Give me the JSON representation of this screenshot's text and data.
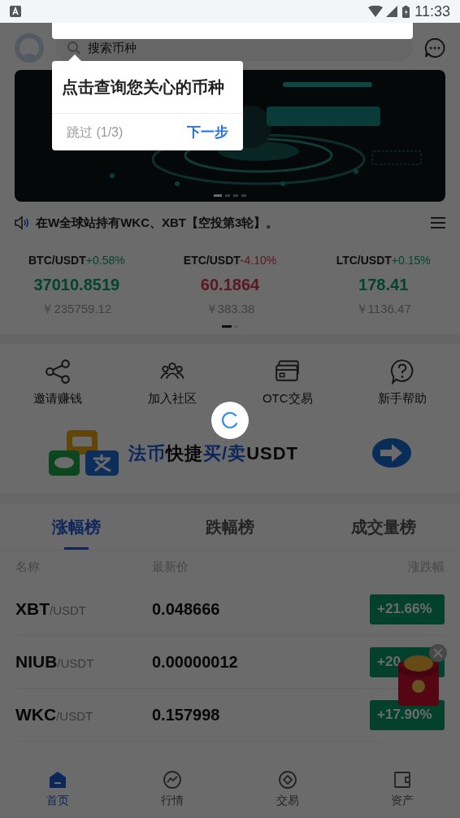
{
  "status_bar": {
    "time": "11:33"
  },
  "header": {
    "search_placeholder": "搜索币种"
  },
  "guide_popup": {
    "message": "点击查询您关心的币种",
    "skip": "跳过 (1/3)",
    "next": "下一步"
  },
  "banner": {
    "kind": "picture",
    "dots": [
      {
        "selected": true
      },
      {
        "selected": false
      },
      {
        "selected": false
      },
      {
        "selected": false
      }
    ]
  },
  "notice": {
    "text": "在W全球站持有WKC、XBT【空投第3轮】。"
  },
  "tickers": [
    {
      "pair": "BTC/USDT",
      "change": "+0.58%",
      "price": "37010.8519",
      "cny": "￥235759.12",
      "kind": "gain"
    },
    {
      "pair": "ETC/USDT",
      "change": "-4.10%",
      "price": "60.1864",
      "cny": "￥383.38",
      "kind": "loss"
    },
    {
      "pair": "LTC/USDT",
      "change": "+0.15%",
      "price": "178.41",
      "cny": "￥1136.47",
      "kind": "gain"
    }
  ],
  "ticker_pages": [
    {
      "selected": true
    },
    {
      "selected": false
    }
  ],
  "shortcuts": [
    {
      "label": "邀请赚钱",
      "kind": "share"
    },
    {
      "label": "加入社区",
      "kind": "people"
    },
    {
      "label": "OTC交易",
      "kind": "cards"
    },
    {
      "label": "新手帮助",
      "kind": "help"
    }
  ],
  "fiat_banner": {
    "segments": [
      {
        "text": "法币",
        "kind": "accent"
      },
      {
        "text": "快捷",
        "kind": "plain"
      },
      {
        "text": "买/卖",
        "kind": "accent"
      },
      {
        "text": "USDT",
        "kind": "plain"
      }
    ]
  },
  "ranking": {
    "tabs": [
      {
        "label": "涨幅榜",
        "selected": true
      },
      {
        "label": "跌幅榜",
        "selected": false
      },
      {
        "label": "成交量榜",
        "selected": false
      }
    ],
    "columns": [
      "名称",
      "最新价",
      "涨跌幅"
    ],
    "rows": [
      {
        "base": "XBT",
        "quote": "/USDT",
        "price": "0.048666",
        "change": "+21.66%"
      },
      {
        "base": "NIUB",
        "quote": "/USDT",
        "price": "0.00000012",
        "change": "+20"
      },
      {
        "base": "WKC",
        "quote": "/USDT",
        "price": "0.157998",
        "change": "+17.90%"
      }
    ]
  },
  "nav": [
    {
      "label": "首页",
      "kind": "home",
      "selected": true
    },
    {
      "label": "行情",
      "kind": "market",
      "selected": false
    },
    {
      "label": "交易",
      "kind": "trade",
      "selected": false
    },
    {
      "label": "资产",
      "kind": "assets",
      "selected": false
    }
  ]
}
